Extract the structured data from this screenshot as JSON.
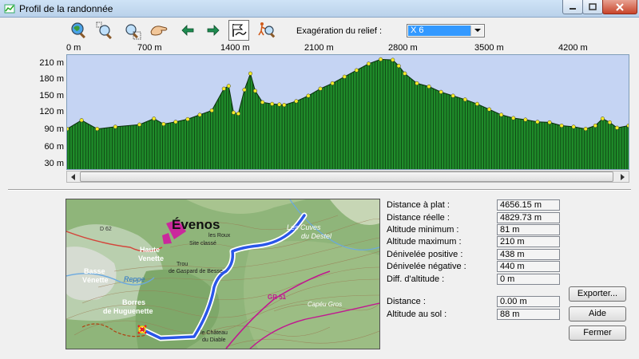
{
  "window": {
    "title": "Profil de la randonnée"
  },
  "toolbar": {
    "buttons": [
      {
        "name": "zoom-fit-button",
        "icon": "magnifier-globe-icon"
      },
      {
        "name": "zoom-in-button",
        "icon": "zoom-in-icon"
      },
      {
        "name": "zoom-out-button",
        "icon": "zoom-out-icon"
      },
      {
        "name": "pan-button",
        "icon": "hand-icon"
      },
      {
        "name": "previous-button",
        "icon": "arrow-left-icon"
      },
      {
        "name": "next-button",
        "icon": "arrow-right-icon"
      },
      {
        "name": "profile-mode-button",
        "icon": "profile-flag-icon",
        "active": true
      },
      {
        "name": "locate-button",
        "icon": "walker-magnifier-icon"
      }
    ],
    "exaggeration_label": "Exagération du relief :",
    "exaggeration_value": "X 6"
  },
  "chart_data": {
    "type": "area",
    "x_ticks": [
      "0 m",
      "700 m",
      "1400 m",
      "2100 m",
      "2800 m",
      "3500 m",
      "4200 m"
    ],
    "y_ticks": [
      "210 m",
      "180 m",
      "150 m",
      "120 m",
      "90 m",
      "60 m",
      "30 m"
    ],
    "xlim": [
      0,
      4656
    ],
    "ylim": [
      10,
      220
    ],
    "x": [
      0,
      120,
      250,
      400,
      600,
      720,
      800,
      900,
      1000,
      1100,
      1200,
      1300,
      1340,
      1380,
      1420,
      1470,
      1520,
      1560,
      1620,
      1700,
      1760,
      1800,
      1900,
      2000,
      2100,
      2200,
      2300,
      2400,
      2500,
      2600,
      2700,
      2750,
      2800,
      2900,
      3000,
      3100,
      3200,
      3300,
      3400,
      3500,
      3600,
      3700,
      3800,
      3900,
      4000,
      4100,
      4200,
      4300,
      4380,
      4440,
      4500,
      4560,
      4656
    ],
    "y": [
      84,
      100,
      84,
      88,
      92,
      103,
      93,
      97,
      102,
      110,
      118,
      158,
      163,
      114,
      112,
      156,
      186,
      154,
      133,
      130,
      129,
      128,
      135,
      145,
      158,
      168,
      180,
      192,
      204,
      212,
      211,
      200,
      186,
      168,
      162,
      152,
      145,
      138,
      130,
      120,
      110,
      104,
      101,
      97,
      96,
      90,
      88,
      84,
      90,
      103,
      96,
      86,
      90
    ],
    "series_color": "#1f8b2a",
    "marker_color": "#f4ec28"
  },
  "stats": [
    {
      "label": "Distance à plat :",
      "value": "4656.15 m"
    },
    {
      "label": "Distance réelle :",
      "value": "4829.73 m"
    },
    {
      "label": "Altitude minimum :",
      "value": "81 m"
    },
    {
      "label": "Altitude maximum :",
      "value": "210 m"
    },
    {
      "label": "Dénivelée positive :",
      "value": "438 m"
    },
    {
      "label": "Dénivelée négative :",
      "value": "440 m"
    },
    {
      "label": "Diff. d'altitude :",
      "value": "0 m"
    }
  ],
  "cursor": {
    "distance_label": "Distance :",
    "distance_value": "0.00 m",
    "altitude_label": "Altitude au sol :",
    "altitude_value": "88 m"
  },
  "buttons": {
    "export": "Exporter...",
    "help": "Aide",
    "close": "Fermer"
  },
  "map": {
    "place_evenos": "Évenos",
    "labels": [
      {
        "text": "Haute",
        "name": "map-label-haute"
      },
      {
        "text": "Venette",
        "name": "map-label-venette"
      },
      {
        "text": "Basse",
        "name": "map-label-basse"
      },
      {
        "text": "Vénette",
        "name": "map-label-venette2"
      },
      {
        "text": "Borres",
        "name": "map-label-borres"
      },
      {
        "text": "de Huguenette",
        "name": "map-label-huguenette"
      },
      {
        "text": "Les Cuves",
        "name": "map-label-cuves"
      },
      {
        "text": "du Destel",
        "name": "map-label-destel"
      },
      {
        "text": "Capéu Gros",
        "name": "map-label-capeu"
      },
      {
        "text": "Trou",
        "name": "map-label-trou"
      },
      {
        "text": "de Gaspard de Besse",
        "name": "map-label-gaspard"
      },
      {
        "text": "le Château",
        "name": "map-label-chateau"
      },
      {
        "text": "du Diable",
        "name": "map-label-diable"
      },
      {
        "text": "GR 51",
        "name": "map-label-gr51"
      },
      {
        "text": "D 62",
        "name": "map-label-d62"
      },
      {
        "text": "Reppe",
        "name": "map-label-reppe"
      },
      {
        "text": "Site classé",
        "name": "map-label-site"
      },
      {
        "text": "les Roux",
        "name": "map-label-roux"
      }
    ],
    "colors": {
      "trail": "#2a56e8",
      "trail_outline": "#ffffff",
      "village": "#d01aa0",
      "road": "#c01890"
    }
  }
}
